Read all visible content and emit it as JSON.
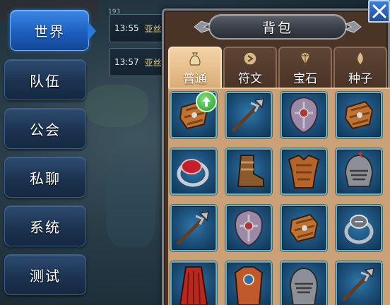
{
  "channels": [
    {
      "label": "世界",
      "active": true
    },
    {
      "label": "队伍",
      "active": false
    },
    {
      "label": "公会",
      "active": false
    },
    {
      "label": "私聊",
      "active": false
    },
    {
      "label": "系统",
      "active": false
    },
    {
      "label": "测试",
      "active": false
    }
  ],
  "messages": [
    {
      "time": "13:55",
      "sender": "亚丝"
    },
    {
      "time": "13:57",
      "sender": "亚丝"
    }
  ],
  "level_badge": "193",
  "bag": {
    "title": "背包",
    "close_icon": "close-icon",
    "tabs": [
      {
        "label": "普通",
        "icon": "pouch-icon",
        "active": true
      },
      {
        "label": "符文",
        "icon": "rune-icon",
        "active": false
      },
      {
        "label": "宝石",
        "icon": "gem-icon",
        "active": false
      },
      {
        "label": "种子",
        "icon": "seed-icon",
        "active": false
      }
    ],
    "items": [
      "bracer-icon",
      "trident-icon",
      "shield-icon",
      "bracer-icon",
      "ring-icon",
      "boots-icon",
      "armor-icon",
      "helmet-icon",
      "trident-icon",
      "shield-icon",
      "bracer-icon",
      "ring-icon",
      "cloak-icon",
      "chestplate-icon",
      "helmet-icon",
      "trident-icon"
    ],
    "upgrade_badge_icon": "upgrade-arrow-icon"
  },
  "colors": {
    "active_channel": "#2c79dc",
    "channel": "#1c3350",
    "bag_frame": "#4a3426",
    "grid_background": "#caa177",
    "slot_border": "#55b8d8",
    "sender_name": "#f1d58a"
  }
}
